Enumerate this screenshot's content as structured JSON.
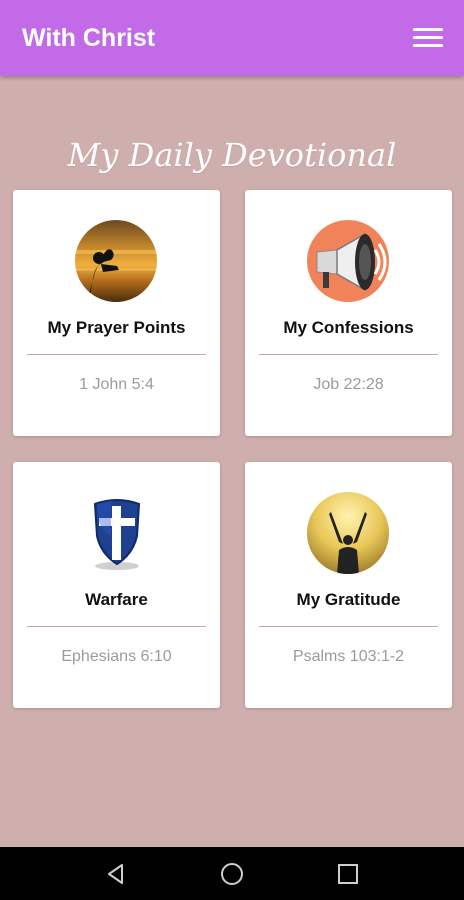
{
  "app_bar": {
    "title": "With Christ",
    "accent": "#c36ae8",
    "menu_icon": "hamburger-menu-icon"
  },
  "background": "#cfaeae",
  "section": {
    "title": "My Daily Devotional"
  },
  "cards": [
    {
      "title": "My Prayer Points",
      "verse": "1 John 5:4",
      "icon": "praying-person-icon"
    },
    {
      "title": "My Confessions",
      "verse": "Job 22:28",
      "icon": "megaphone-icon"
    },
    {
      "title": "Warfare",
      "verse": "Ephesians 6:10",
      "icon": "cross-shield-icon"
    },
    {
      "title": "My Gratitude",
      "verse": "Psalms 103:1-2",
      "icon": "raised-hands-icon"
    }
  ],
  "nav_bar": {
    "back_icon": "back-triangle-icon",
    "home_icon": "home-circle-icon",
    "recents_icon": "recents-square-icon"
  }
}
